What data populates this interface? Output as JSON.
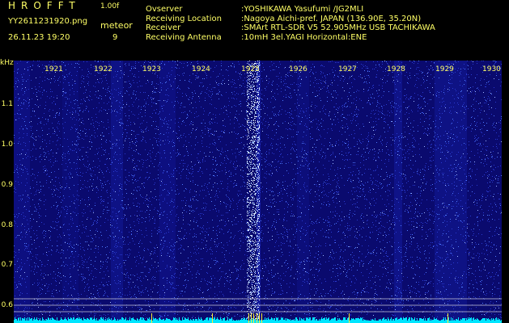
{
  "header": {
    "brand": "HROFFT",
    "version": "1.00f",
    "filename": "YY2611231920.png",
    "datetime": "26.11.23 19:20",
    "meteor_label": "meteor",
    "meteor_count": "9"
  },
  "station": {
    "rows": [
      {
        "key": "Ovserver",
        "value": ":YOSHIKAWA Yasufumi /JG2MLI"
      },
      {
        "key": "Receiving Location",
        "value": ":Nagoya Aichi-pref. JAPAN (136.90E, 35.20N)"
      },
      {
        "key": "Receiver",
        "value": ":SMArt RTL-SDR V5 52.905MHz USB TACHIKAWA"
      },
      {
        "key": "Receiving Antenna",
        "value": ":10mH 3el.YAGI Horizontal:ENE"
      }
    ]
  },
  "axes": {
    "y_unit": "kHz",
    "y_ticks": [
      "1.1",
      "1.0",
      "0.9",
      "0.8",
      "0.7",
      "0.6"
    ],
    "x_ticks": [
      "1921",
      "1922",
      "1923",
      "1924",
      "1925",
      "1926",
      "1927",
      "1928",
      "1929",
      "1930"
    ]
  },
  "colors": {
    "background": "#000000",
    "label": "#ffff66",
    "noise_dark": "#0a0a6e",
    "noise_bright": "#4f7bff",
    "baseline": "#00e5ff"
  }
}
